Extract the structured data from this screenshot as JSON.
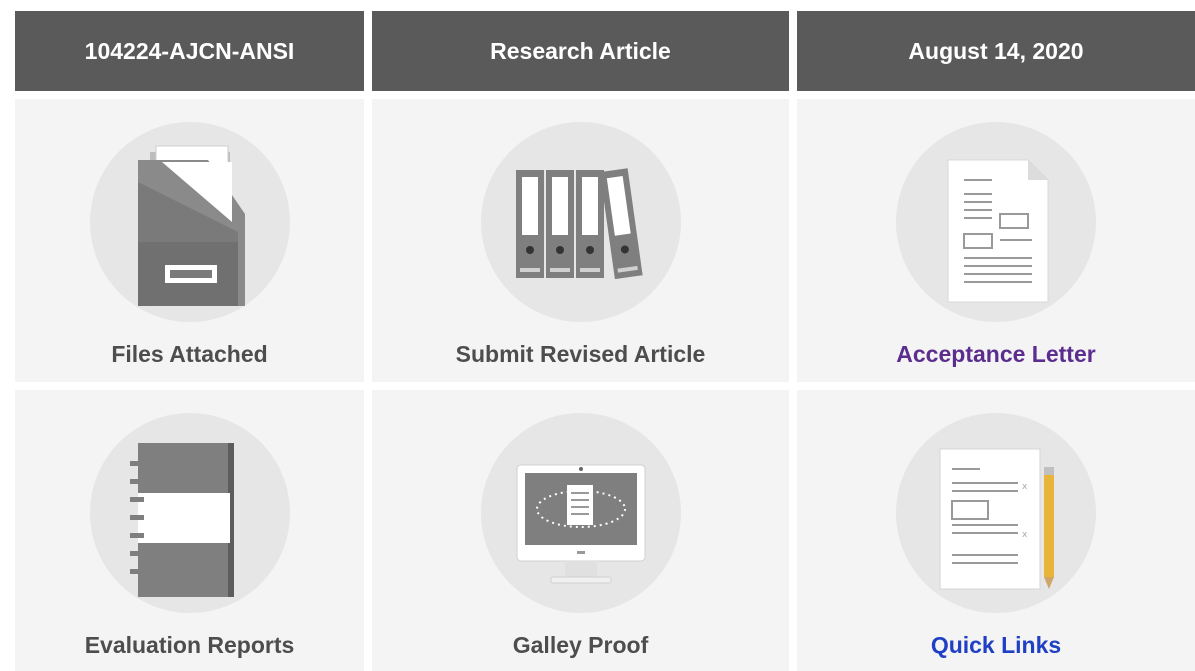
{
  "header": {
    "manuscript_id": "104224-AJCN-ANSI",
    "article_type": "Research Article",
    "date": "August 14, 2020"
  },
  "tiles": {
    "files_attached": {
      "label": "Files Attached",
      "icon": "file-box-icon"
    },
    "submit_revised_article": {
      "label": "Submit Revised Article",
      "icon": "binders-icon"
    },
    "acceptance_letter": {
      "label": "Acceptance Letter",
      "icon": "document-icon",
      "color": "#5b2d8e"
    },
    "evaluation_reports": {
      "label": "Evaluation Reports",
      "icon": "notebook-icon"
    },
    "galley_proof": {
      "label": "Galley Proof",
      "icon": "monitor-icon"
    },
    "quick_links": {
      "label": "Quick Links",
      "icon": "checklist-pencil-icon",
      "color": "#1f3fc4"
    }
  },
  "colors": {
    "header_bg": "#5a5a5a",
    "card_bg": "#f4f4f4",
    "circle_bg": "#e6e6e6",
    "label_gray": "#4d4d4d"
  }
}
